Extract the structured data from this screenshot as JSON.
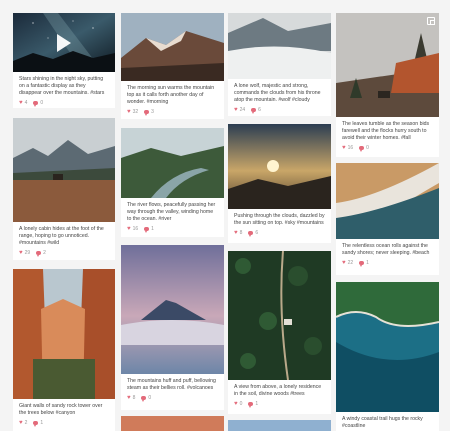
{
  "posts": [
    {
      "caption": "Stars shining in the night sky, putting on a fantastic display as they disappear over the mountains. #stars",
      "likes": "4",
      "comments": "0",
      "media": "video-icon"
    },
    {
      "caption": "The morning sun warms the mountain top as it calls forth another day of wonder. #morning",
      "likes": "32",
      "comments": "3"
    },
    {
      "caption": "A lone wolf, majestic and strong, commands the clouds from his throne atop the mountain. #wolf #cloudy",
      "likes": "24",
      "comments": "6"
    },
    {
      "caption": "The leaves tumble as the season bids farewell and the flocks hurry south to avoid their winter homes. #fall",
      "likes": "16",
      "comments": "0",
      "media": "gallery-icon"
    },
    {
      "caption": "A lonely cabin hides at the foot of the range, hoping to go unnoticed. #mountains #wild",
      "likes": "29",
      "comments": "2"
    },
    {
      "caption": "The river flows, peacefully passing her way through the valley, winding home to the ocean. #river",
      "likes": "16",
      "comments": "1"
    },
    {
      "caption": "Pushing through the clouds, dazzled by the sun sitting on top. #sky #mountains",
      "likes": "8",
      "comments": "6"
    },
    {
      "caption": "The relentless ocean rolls against the sandy shores; never sleeping. #beach",
      "likes": "22",
      "comments": "1"
    },
    {
      "caption": "The mountains huff and puff, bellowing steam as their bellies roll. #volcanoes",
      "likes": "8",
      "comments": "0"
    },
    {
      "caption": "A view from above, a lonely residence in the soil, divine woods #trees",
      "likes": "0",
      "comments": "1"
    },
    {
      "caption": "Giant walls of sandy rock tower over the trees below #canyon",
      "likes": "2",
      "comments": "1"
    },
    {
      "caption": "A windy coastal trail hugs the rocky #coastline",
      "likes": "",
      "comments": ""
    }
  ],
  "colors": {
    "accent": "#e36a7a",
    "background": "#f4f4f4"
  }
}
